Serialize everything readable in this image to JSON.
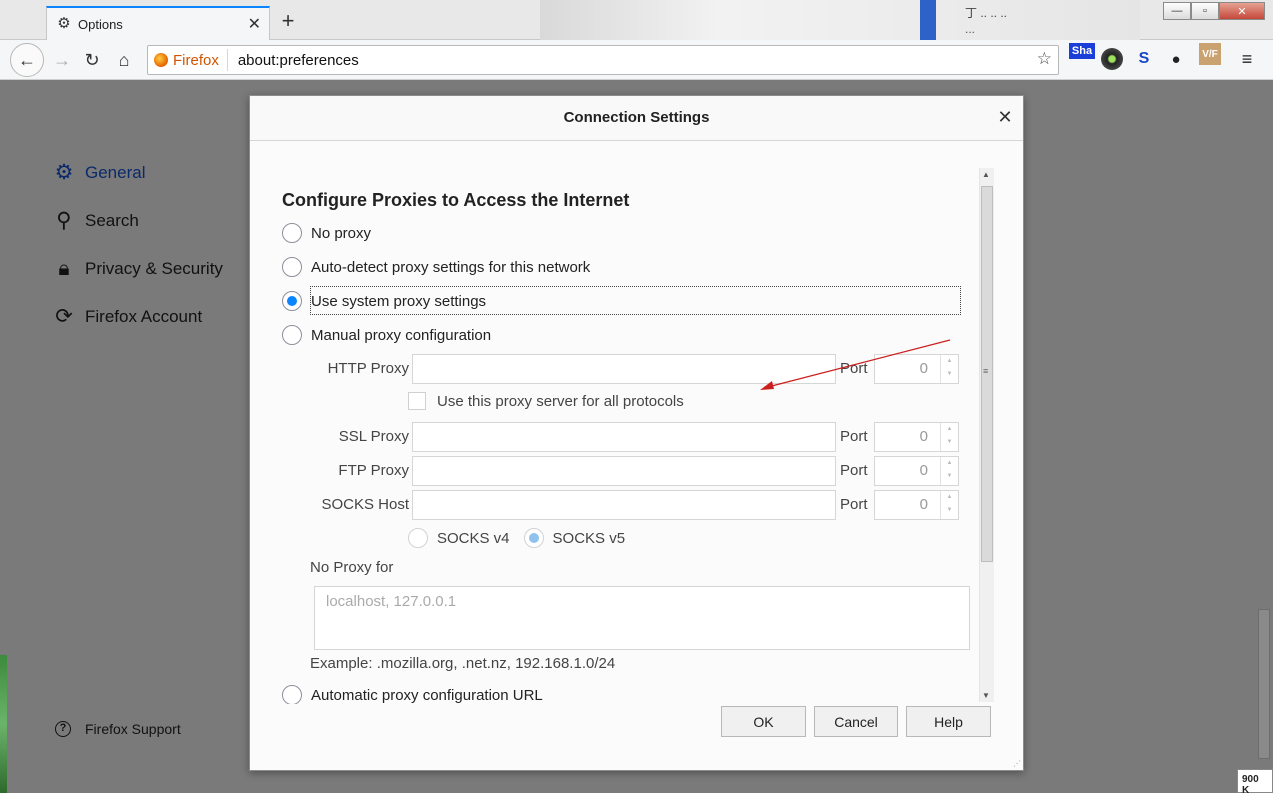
{
  "browser": {
    "tab_title": "Options",
    "new_tab": "+",
    "desktop_text_1": "丁 ..  .. ..",
    "desktop_text_2": "...",
    "identity_label": "Firefox",
    "url": "about:preferences",
    "ext_sha": "Sha",
    "ext_vf": "V/F",
    "window_controls": [
      "—",
      "▫",
      "✕"
    ]
  },
  "sidebar": {
    "items": [
      {
        "label": "General",
        "icon": "gear-icon",
        "active": true
      },
      {
        "label": "Search",
        "icon": "search-icon"
      },
      {
        "label": "Privacy & Security",
        "icon": "lock-icon"
      },
      {
        "label": "Firefox Account",
        "icon": "sync-icon"
      }
    ],
    "support_label": "Firefox Support"
  },
  "status_text": "900 K",
  "dialog": {
    "title": "Connection Settings",
    "heading": "Configure Proxies to Access the Internet",
    "options": {
      "no_proxy": "No proxy",
      "auto_detect": "Auto-detect proxy settings for this network",
      "system": "Use system proxy settings",
      "manual": "Manual proxy configuration",
      "auto_url": "Automatic proxy configuration URL"
    },
    "selected_option": "system",
    "http_proxy_label": "HTTP Proxy",
    "ssl_proxy_label": "SSL Proxy",
    "ftp_proxy_label": "FTP Proxy",
    "socks_host_label": "SOCKS Host",
    "port_label": "Port",
    "http_port": "0",
    "ssl_port": "0",
    "ftp_port": "0",
    "socks_port": "0",
    "use_for_all": "Use this proxy server for all protocols",
    "socks_v4": "SOCKS v4",
    "socks_v5": "SOCKS v5",
    "socks_selected": "v5",
    "no_proxy_for_label": "No Proxy for",
    "no_proxy_placeholder": "localhost, 127.0.0.1",
    "example": "Example: .mozilla.org, .net.nz, 192.168.1.0/24",
    "ok": "OK",
    "cancel": "Cancel",
    "help": "Help"
  },
  "colors": {
    "accent": "#0a84ff",
    "annotation_arrow": "#cc1f1f"
  }
}
